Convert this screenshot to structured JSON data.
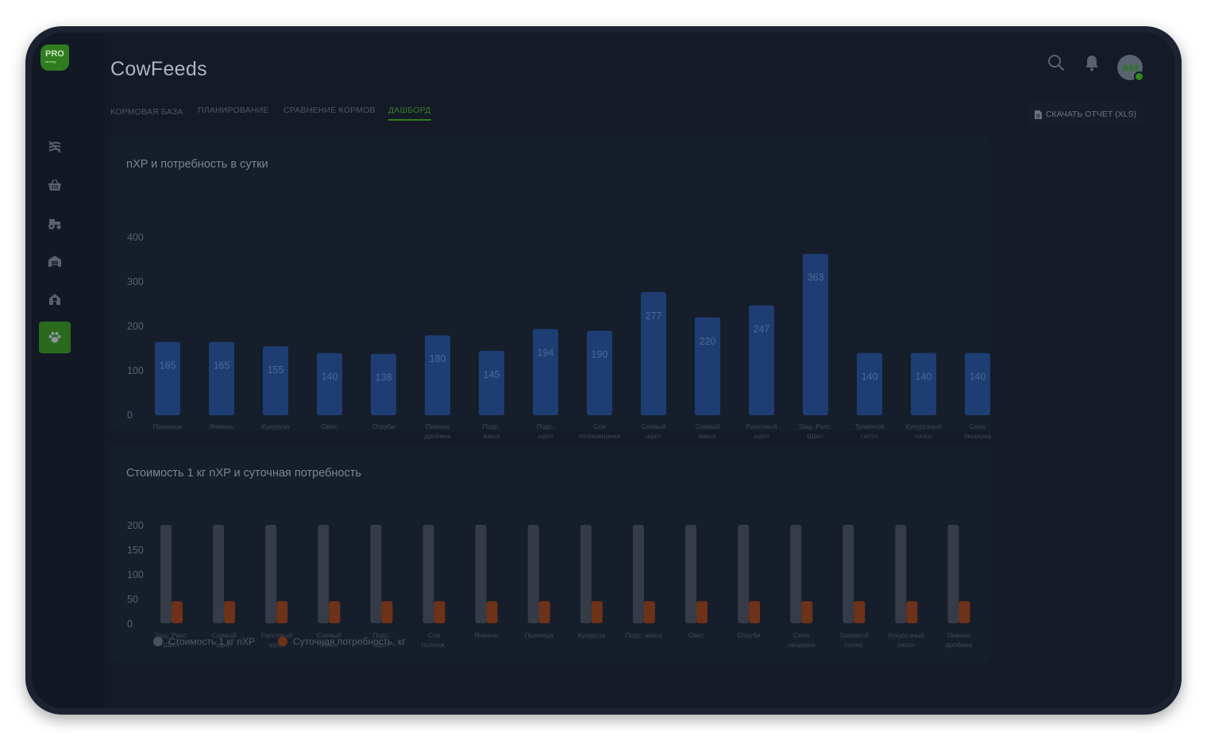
{
  "app": {
    "title": "CowFeeds",
    "logo_text": "PRO",
    "logo_subtext": "farming"
  },
  "tabs": [
    {
      "label": "КОРМОВАЯ БАЗА",
      "active": false
    },
    {
      "label": "ПЛАНИРОВАНИЕ",
      "active": false
    },
    {
      "label": "СРАВНЕНИЕ КОРМОВ",
      "active": false
    },
    {
      "label": "ДАШБОРД",
      "active": true
    }
  ],
  "sidebar": {
    "items": [
      {
        "icon": "fields-icon",
        "active": false
      },
      {
        "icon": "basket-icon",
        "active": false
      },
      {
        "icon": "tractor-icon",
        "active": false
      },
      {
        "icon": "barn-icon",
        "active": false
      },
      {
        "icon": "farm-building-icon",
        "active": false
      },
      {
        "icon": "paw-icon",
        "active": true
      }
    ]
  },
  "header": {
    "search_icon": "search-icon",
    "bell_icon": "bell-icon",
    "avatar_initials": "AM",
    "download_label": "СКАЧАТЬ ОТЧЕТ (XLS)"
  },
  "colors": {
    "bar_blue": "#1e3e73",
    "bar_gray": "#353c47",
    "bar_orange": "#6e3218",
    "accent_green": "#2f7d1f"
  },
  "chart_data": [
    {
      "type": "bar",
      "title": "nXP и потребность в сутки",
      "categories": [
        [
          "Пшеница"
        ],
        [
          "Ячмень"
        ],
        [
          "Кукуруза"
        ],
        [
          "Овес"
        ],
        [
          "Отруби"
        ],
        [
          "Пивная",
          "дробина"
        ],
        [
          "Подс.",
          "жмых"
        ],
        [
          "Подс.",
          "шрот"
        ],
        [
          "Соя",
          "полножирная"
        ],
        [
          "Соевый",
          "шрот"
        ],
        [
          "Соевый",
          "жмых"
        ],
        [
          "Рапсовый",
          "шрот"
        ],
        [
          "Защ. Рапс.",
          "Шрот"
        ],
        [
          "Травяной",
          "силос"
        ],
        [
          "Кукурузный",
          "силос"
        ],
        [
          "Сено",
          "люцерна"
        ]
      ],
      "values": [
        165,
        165,
        155,
        140,
        138,
        180,
        145,
        194,
        190,
        277,
        220,
        247,
        363,
        140,
        140,
        140
      ],
      "yticks": [
        0,
        100,
        200,
        300,
        400
      ],
      "ylim": [
        0,
        400
      ]
    },
    {
      "type": "bar",
      "title": "Стоимость 1 кг nXP и суточная потребность",
      "categories": [
        [
          "Защ. Рапс.",
          "Шрот"
        ],
        [
          "Соевый",
          "шрот"
        ],
        [
          "Рапсовый",
          "шрот"
        ],
        [
          "Соевый",
          "жмых"
        ],
        [
          "Подс.",
          "шрот"
        ],
        [
          "Соя",
          "полнож."
        ],
        [
          "Ячмень"
        ],
        [
          "Пшеница"
        ],
        [
          "Кукуруза"
        ],
        [
          "Подс. жмых"
        ],
        [
          "Овес"
        ],
        [
          "Отруби"
        ],
        [
          "Сено",
          "люцерна"
        ],
        [
          "Травяной",
          "силос"
        ],
        [
          "Кукурузный",
          "силос"
        ],
        [
          "Пивная",
          "дробина"
        ]
      ],
      "series": [
        {
          "name": "Стоимость 1 кг nXP",
          "values": [
            200,
            200,
            200,
            200,
            200,
            200,
            200,
            200,
            200,
            200,
            200,
            200,
            200,
            200,
            200,
            200
          ]
        },
        {
          "name": "Суточная потребность, кг",
          "values": [
            45,
            45,
            45,
            45,
            45,
            45,
            45,
            45,
            45,
            45,
            45,
            45,
            45,
            45,
            45,
            45
          ]
        }
      ],
      "yticks": [
        0,
        50,
        100,
        150,
        200
      ],
      "ylim": [
        0,
        200
      ],
      "legend": "bottom-left"
    }
  ]
}
